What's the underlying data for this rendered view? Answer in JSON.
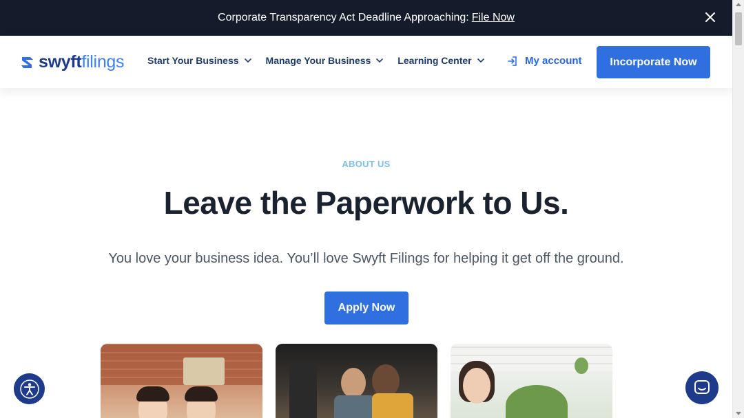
{
  "announcement": {
    "text": "Corporate Transparency Act Deadline Approaching:",
    "link": "File Now"
  },
  "header": {
    "logo_part1": "swyft",
    "logo_part2": "filings",
    "nav": [
      {
        "label": "Start Your Business"
      },
      {
        "label": "Manage Your Business"
      },
      {
        "label": "Learning Center"
      }
    ],
    "account_label": "My account",
    "cta_label": "Incorporate Now"
  },
  "hero": {
    "eyebrow": "ABOUT US",
    "headline": "Leave the Paperwork to Us.",
    "subhead": "You love your business idea. You’ll love Swyft Filings for helping it get off the ground.",
    "button_label": "Apply Now"
  },
  "colors": {
    "brand_dark": "#1e3a8a",
    "brand_blue": "#2f6fe0",
    "topbar_bg": "#141c2b",
    "eyebrow": "#7cc0e8"
  },
  "icons": {
    "close": "close-icon",
    "login": "login-icon",
    "chevron": "chevron-down-icon",
    "accessibility": "accessibility-icon",
    "chat": "chat-icon"
  }
}
